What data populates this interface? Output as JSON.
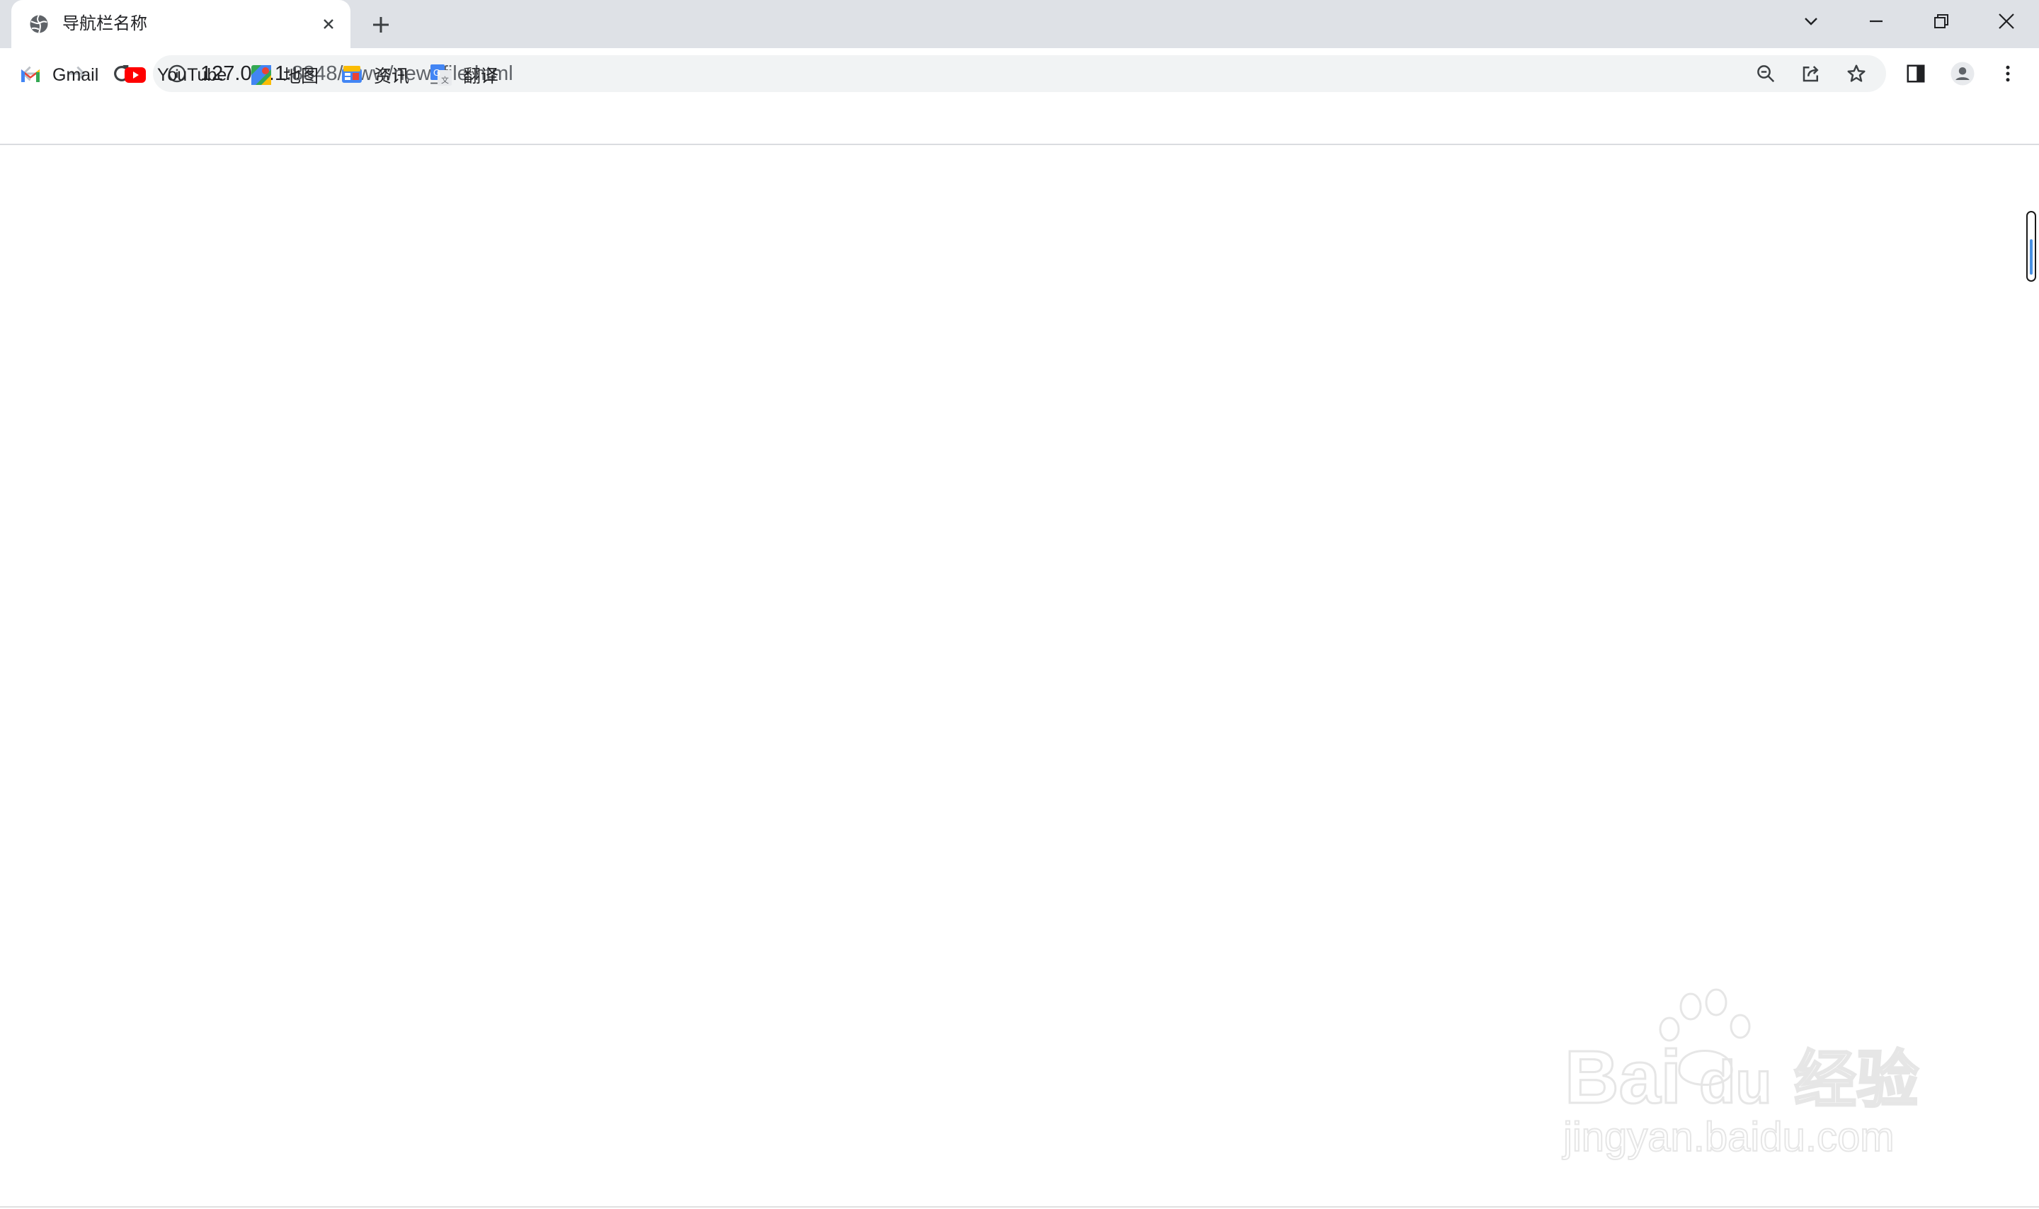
{
  "tab": {
    "title": "导航栏名称",
    "favicon": "globe-icon"
  },
  "window_controls": [
    "tab-search-icon",
    "minimize-icon",
    "restore-icon",
    "close-icon"
  ],
  "address_bar": {
    "host": "127.0.0.1",
    "path": ":8848/www/new_file.html",
    "info_icon": "info-icon"
  },
  "omnibox_icons": [
    "zoom-icon",
    "share-icon",
    "star-icon"
  ],
  "toolbar_icons": [
    "side-panel-icon",
    "profile-icon",
    "menu-icon"
  ],
  "bookmarks": [
    {
      "label": "Gmail",
      "icon": "gmail-icon"
    },
    {
      "label": "YouTube",
      "icon": "youtube-icon"
    },
    {
      "label": "地图",
      "icon": "maps-icon"
    },
    {
      "label": "资讯",
      "icon": "news-icon"
    },
    {
      "label": "翻译",
      "icon": "translate-icon"
    }
  ],
  "watermark": {
    "brand": "Bai",
    "brand2": "du",
    "cn": "经验",
    "domain": "jingyan.baidu.com"
  },
  "colors": {
    "tab_strip": "#dee1e6",
    "omnibox": "#f1f3f4",
    "icon": "#5f6368",
    "youtube_red": "#ff0000",
    "scroll_thumb": "#4a90e2"
  }
}
